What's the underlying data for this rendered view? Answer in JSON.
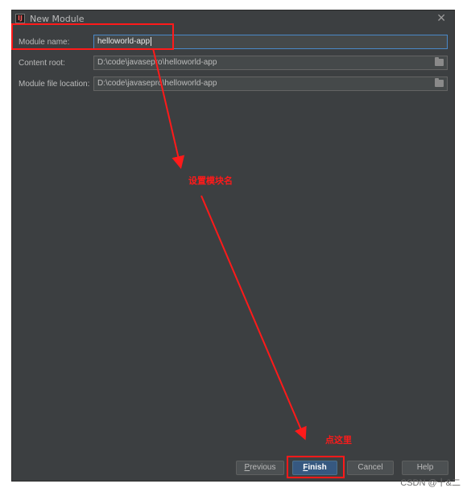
{
  "window": {
    "title": "New Module",
    "app_icon_text": "IJ"
  },
  "form": {
    "module_name_label": "Module name:",
    "module_name_value": "helloworld-app",
    "content_root_label": "Content root:",
    "content_root_value": "D:\\code\\javasepro\\helloworld-app",
    "module_file_location_label": "Module file location:",
    "module_file_location_value": "D:\\code\\javasepro\\helloworld-app"
  },
  "buttons": {
    "previous_first": "P",
    "previous_rest": "revious",
    "finish_first": "F",
    "finish_rest": "inish",
    "cancel": "Cancel",
    "help": "Help"
  },
  "annotations": {
    "set_module_name": "设置模块名",
    "click_here": "点这里",
    "color": "#ff1a1a"
  },
  "watermark": "CSDN @十&二",
  "colors": {
    "dialog_bg": "#3c3f41",
    "field_bg": "#45494a",
    "focus_border": "#4a88c7",
    "primary_button": "#365880"
  }
}
